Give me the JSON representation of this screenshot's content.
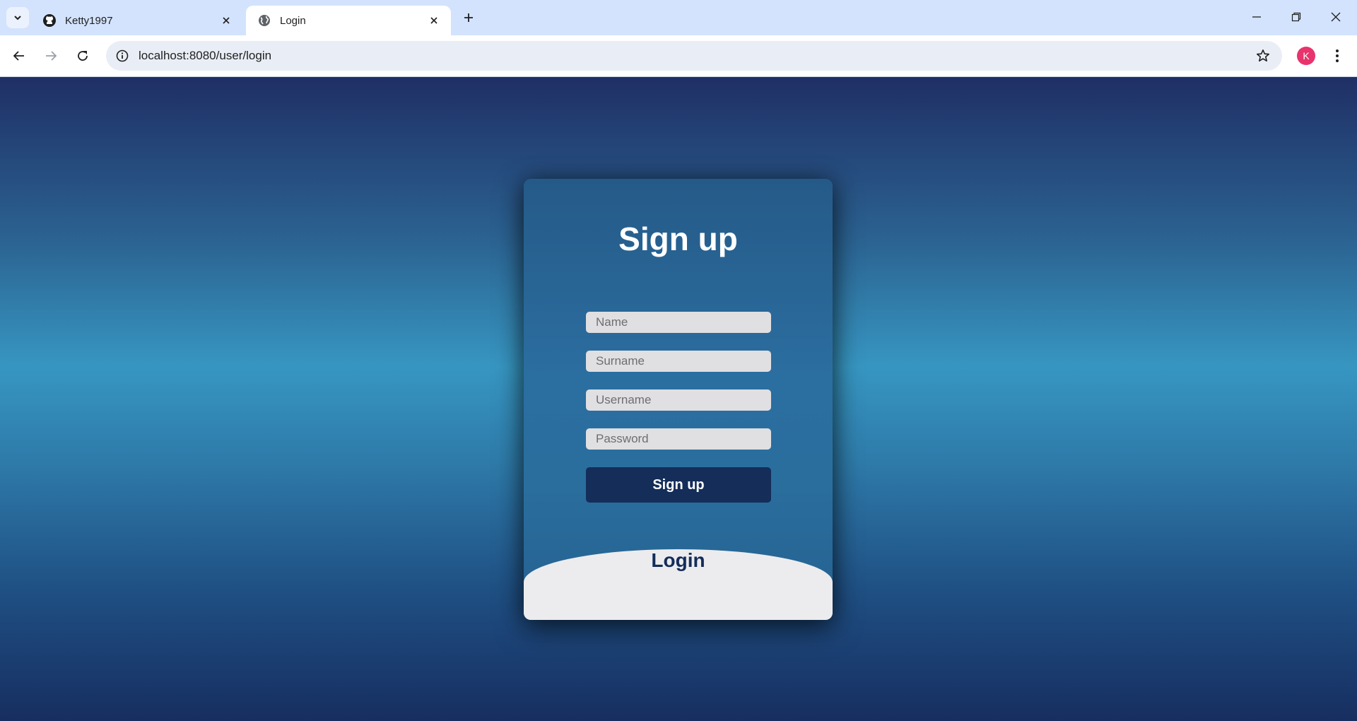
{
  "browser": {
    "tabs": [
      {
        "title": "Ketty1997",
        "icon": "github-icon"
      },
      {
        "title": "Login",
        "icon": "globe-icon",
        "active": true
      }
    ],
    "url": "localhost:8080/user/login",
    "profile_initial": "K",
    "profile_color": "#e8336d"
  },
  "form": {
    "heading": "Sign up",
    "fields": {
      "name_placeholder": "Name",
      "surname_placeholder": "Surname",
      "username_placeholder": "Username",
      "password_placeholder": "Password"
    },
    "submit_label": "Sign up",
    "login_label": "Login"
  },
  "colors": {
    "button": "#142d59",
    "input_bg": "#e0dfe1",
    "login_panel": "#ececee"
  }
}
